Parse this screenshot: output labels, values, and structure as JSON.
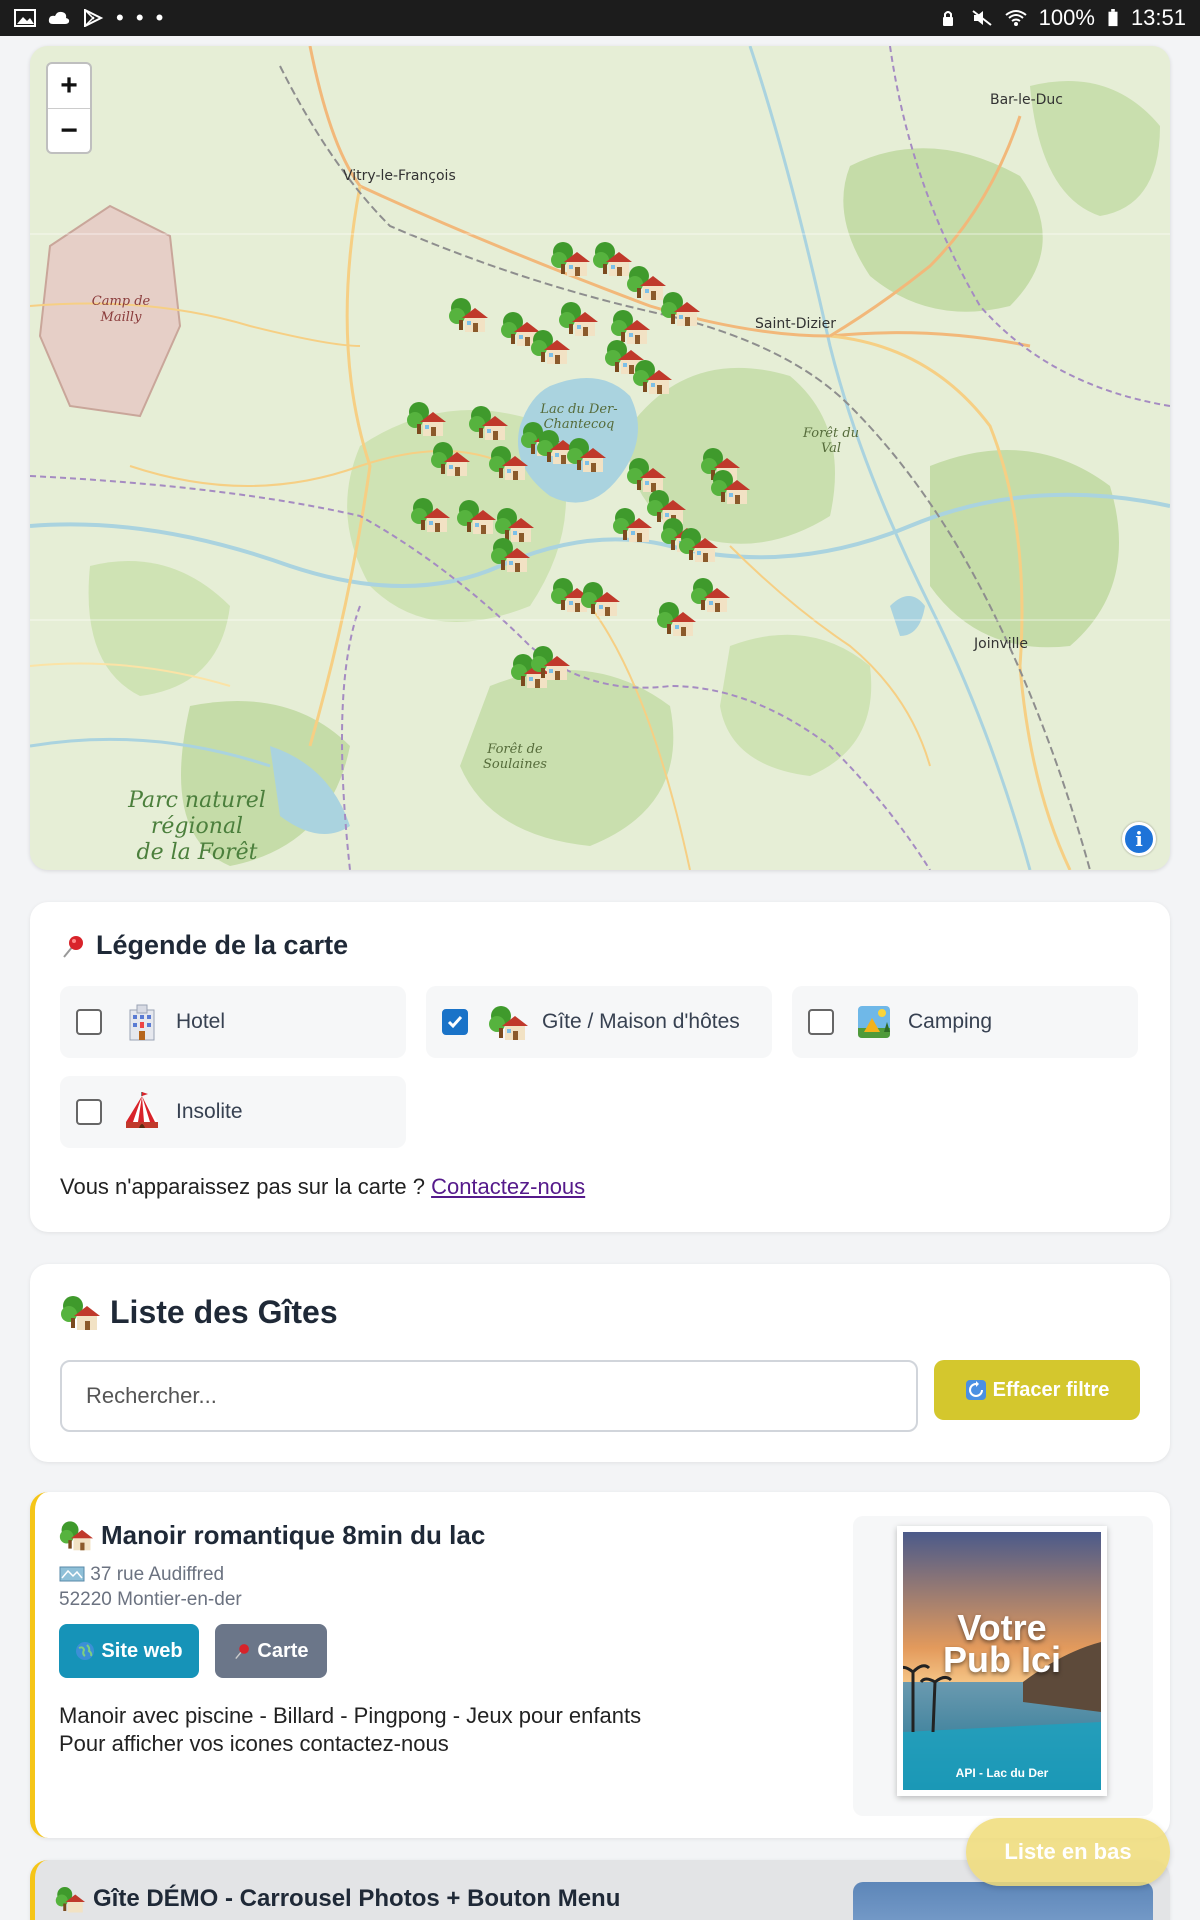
{
  "status_bar": {
    "left_icons": [
      "gallery-icon",
      "cloud-icon",
      "play-store-icon"
    ],
    "overflow": "• • •",
    "battery": "100%",
    "time": "13:51"
  },
  "map": {
    "zoom_in": "+",
    "zoom_out": "−",
    "labels": {
      "bar_le_duc": "Bar-le-Duc",
      "vitry": "Vitry-le-François",
      "saint_dizier": "Saint-Dizier",
      "lac_du_der": "Lac du Der-Chantecoq",
      "foret_du_val": "Forêt du Val",
      "joinville": "Joinville",
      "foret_soulaines": "Forêt de Soulaines",
      "camp_mailly": "Camp de Mailly",
      "parc_line1": "Parc naturel",
      "parc_line2": "régional",
      "parc_line3": "de la Forêt"
    },
    "info": "i",
    "marker_icon": "gite-house-icon"
  },
  "legend": {
    "title": "Légende de la carte",
    "title_icon": "pushpin-icon",
    "items": [
      {
        "label": "Hotel",
        "icon": "hotel-icon",
        "checked": false
      },
      {
        "label": "Gîte / Maison d'hôtes",
        "icon": "gite-house-icon",
        "checked": true
      },
      {
        "label": "Camping",
        "icon": "camping-icon",
        "checked": false
      },
      {
        "label": "Insolite",
        "icon": "circus-tent-icon",
        "checked": false
      }
    ],
    "contact_text": "Vous n'apparaissez pas sur la carte ? ",
    "contact_link": "Contactez-nous"
  },
  "list": {
    "title": "Liste des Gîtes",
    "search_placeholder": "Rechercher...",
    "clear_button": "Effacer filtre"
  },
  "listings": [
    {
      "title": "Manoir romantique 8min du lac",
      "address_line1": "37 rue Audiffred",
      "address_line2": "52220 Montier-en-der",
      "site_button": "Site web",
      "map_button": "Carte",
      "desc_line1": "Manoir avec piscine - Billard - Pingpong - Jeux pour enfants",
      "desc_line2": "Pour afficher vos icones contactez-nous",
      "ad_title_line1": "Votre",
      "ad_title_line2": "Pub Ici",
      "ad_caption": "API - Lac du Der"
    },
    {
      "title": "Gîte DÉMO - Carrousel Photos + Bouton Menu"
    }
  ],
  "floating_button": "Liste en bas",
  "colors": {
    "clear_button": "#d4c72d",
    "site_button": "#1693b8",
    "map_button": "#6b7689",
    "listing_accent": "#f5c518",
    "checkbox_checked": "#1a73c8"
  }
}
